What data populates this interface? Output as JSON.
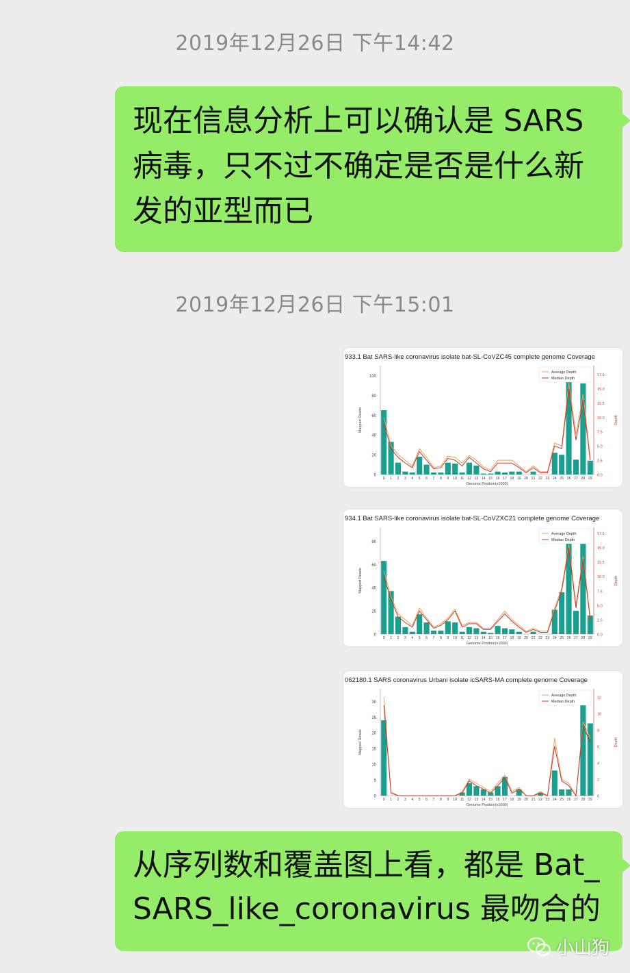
{
  "messages": {
    "ts1": "2019年12月26日 下午14:42",
    "msg1_lines": [
      "现在信息分析上可以确认是 SARS",
      "病毒，只不过不确定是否是什么新",
      "发的亚型而已"
    ],
    "ts2": "2019年12月26日 下午15:01",
    "msg2_lines": [
      "从序列数和覆盖图上看，都是 Bat_",
      "SARS_like_coronavirus 最吻合的"
    ]
  },
  "watermark": {
    "text": "小山狗",
    "logo": "wechat-logo"
  },
  "colors": {
    "bubble": "#95ec69",
    "bar": "#1a9e8e",
    "avg_line": "#e8a15a",
    "median_line": "#c0392b",
    "background": "#ededed"
  },
  "chart_data": [
    {
      "type": "bar",
      "title": "933.1 Bat SARS-like coronavirus isolate bat-SL-CoVZC45 complete genome Coverage",
      "xlabel": "Genome Position(x1000)",
      "ylabel": "Mapped Reads",
      "y2label": "Depth",
      "legend": [
        "Average Depth",
        "Median Depth"
      ],
      "legend_position": "top-right",
      "categories": [
        "0",
        "1",
        "2",
        "3",
        "4",
        "5",
        "6",
        "7",
        "8",
        "9",
        "10",
        "11",
        "12",
        "13",
        "14",
        "15",
        "16",
        "17",
        "18",
        "19",
        "20",
        "21",
        "22",
        "23",
        "24",
        "25",
        "26",
        "27",
        "28",
        "29"
      ],
      "values": [
        65,
        33,
        12,
        3,
        2,
        18,
        10,
        2,
        2,
        12,
        11,
        2,
        12,
        9,
        1,
        1,
        3,
        2,
        3,
        3,
        0,
        3,
        0,
        0,
        22,
        20,
        100,
        15,
        92,
        14
      ],
      "ylim": [
        0,
        110
      ],
      "yticks": [
        "0",
        "20",
        "40",
        "60",
        "80",
        "100"
      ],
      "y2ticks": [
        "0.0",
        "2.5",
        "5.0",
        "7.5",
        "10.0",
        "12.5",
        "15.0",
        "17.5"
      ],
      "y2lim": [
        0,
        19
      ],
      "avg_depth": [
        10,
        5,
        3.5,
        2.5,
        1.5,
        4.5,
        3,
        1.2,
        1.5,
        3.2,
        3,
        2,
        3.3,
        2.5,
        1.3,
        0.8,
        2.5,
        2.5,
        2.5,
        1.5,
        0.5,
        1.5,
        0.5,
        0.5,
        5.5,
        5,
        16,
        7,
        14,
        3
      ],
      "median_depth": [
        9,
        4.5,
        3,
        2,
        1.2,
        4,
        2.5,
        1,
        1.2,
        2.8,
        2.5,
        1.5,
        3,
        2,
        1,
        0.5,
        2,
        2,
        2,
        1.2,
        0.3,
        1.2,
        0.3,
        0.3,
        5,
        4.5,
        15,
        6,
        13,
        2.5
      ]
    },
    {
      "type": "bar",
      "title": "934.1 Bat SARS-like coronavirus isolate bat-SL-CoVZXC21 complete genome Coverage",
      "xlabel": "Genome Position(x1000)",
      "ylabel": "Mapped Reads",
      "y2label": "Depth",
      "legend": [
        "Average Depth",
        "Median Depth"
      ],
      "legend_position": "top-right",
      "categories": [
        "0",
        "1",
        "2",
        "3",
        "4",
        "5",
        "6",
        "7",
        "8",
        "9",
        "10",
        "11",
        "12",
        "13",
        "14",
        "15",
        "16",
        "17",
        "18",
        "19",
        "20",
        "21",
        "22",
        "23",
        "24",
        "25",
        "26",
        "27",
        "28",
        "29"
      ],
      "values": [
        63,
        37,
        15,
        6,
        2,
        17,
        10,
        3,
        3,
        11,
        10,
        2,
        6,
        5,
        2,
        1,
        7,
        5,
        4,
        2,
        0,
        2,
        0,
        0,
        21,
        36,
        90,
        20,
        82,
        16
      ],
      "ylim": [
        0,
        92
      ],
      "yticks": [
        "0",
        "20",
        "40",
        "60",
        "80"
      ],
      "y2ticks": [
        "0.0",
        "2.5",
        "5.0",
        "7.5",
        "10.0",
        "12.5",
        "15.0",
        "17.5"
      ],
      "y2lim": [
        0,
        18.5
      ],
      "avg_depth": [
        11,
        6.5,
        3.5,
        2.5,
        1.5,
        4.5,
        2.8,
        1.2,
        1.8,
        2.8,
        4.3,
        1.5,
        2,
        2,
        1,
        1,
        2.5,
        4,
        2.5,
        1.5,
        0.5,
        1,
        0.5,
        0.5,
        4.5,
        8,
        15.5,
        5,
        13.5,
        3
      ],
      "median_depth": [
        10,
        6,
        3,
        2,
        1.2,
        4,
        2.5,
        1,
        1.5,
        2.5,
        4,
        1.2,
        1.8,
        1.8,
        0.8,
        0.8,
        2.2,
        3.5,
        2.2,
        1.2,
        0.3,
        0.8,
        0.3,
        0.3,
        4,
        7.5,
        15,
        4.5,
        13,
        2.5
      ]
    },
    {
      "type": "bar",
      "title": "062180.1 SARS coronavirus Urbani isolate icSARS-MA complete genome Coverage",
      "xlabel": "Genome Position(x1000)",
      "ylabel": "Mapped Reads",
      "y2label": "Depth",
      "legend": [
        "Average Depth",
        "Median Depth"
      ],
      "legend_position": "top-right",
      "categories": [
        "0",
        "1",
        "2",
        "3",
        "4",
        "5",
        "6",
        "7",
        "8",
        "9",
        "10",
        "11",
        "12",
        "13",
        "14",
        "15",
        "16",
        "17",
        "18",
        "19",
        "20",
        "21",
        "22",
        "23",
        "24",
        "25",
        "26",
        "27",
        "28",
        "29"
      ],
      "values": [
        24,
        0,
        0,
        0,
        0,
        0,
        0,
        0,
        0,
        0,
        0,
        1,
        4,
        3,
        2,
        1,
        3,
        6,
        0,
        2,
        0,
        0,
        1,
        0,
        8,
        2,
        2,
        0,
        29,
        23
      ],
      "ylim": [
        0,
        34
      ],
      "yticks": [
        "0",
        "5",
        "10",
        "15",
        "20",
        "25",
        "30"
      ],
      "y2ticks": [
        "0",
        "2",
        "4",
        "6",
        "8",
        "10",
        "12"
      ],
      "y2lim": [
        0,
        13
      ],
      "avg_depth": [
        12,
        0.5,
        0,
        0,
        0,
        0,
        0,
        0,
        0,
        0,
        0,
        0.5,
        2,
        1.5,
        1,
        0.5,
        1.5,
        2.5,
        0.5,
        1,
        0,
        0,
        0.5,
        0,
        7,
        2,
        1.5,
        0,
        9,
        7
      ],
      "median_depth": [
        11,
        0.3,
        0,
        0,
        0,
        0,
        0,
        0,
        0,
        0,
        0,
        0.3,
        1.8,
        1.2,
        0.8,
        0.3,
        1.2,
        2.2,
        0.3,
        0.8,
        0,
        0,
        0.3,
        0,
        6,
        1.8,
        1.2,
        0,
        8.5,
        6.5
      ]
    }
  ]
}
